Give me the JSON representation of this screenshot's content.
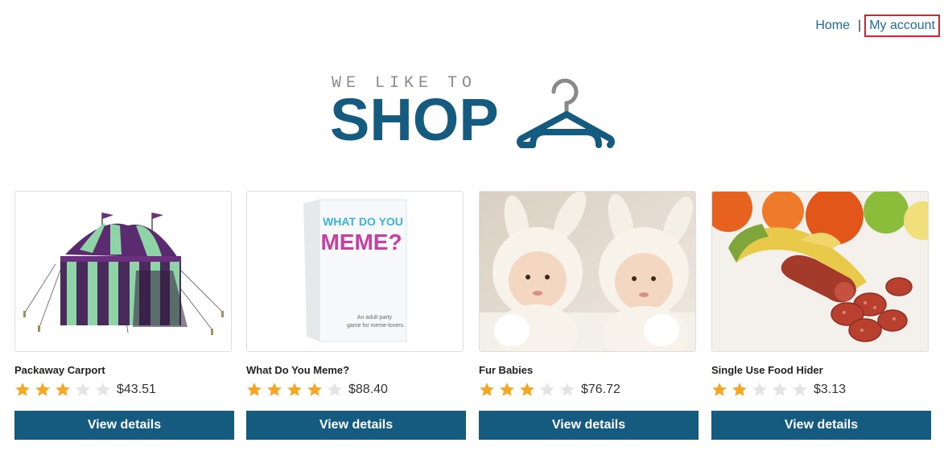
{
  "nav": {
    "home_label": "Home",
    "separator": "|",
    "account_label": "My account",
    "link_color": "#1f6b9e",
    "highlight_color": "#d9232e"
  },
  "logo": {
    "tagline": "WE LIKE TO",
    "word": "SHOP",
    "icon": "hanger-icon",
    "primary_color": "#155b80",
    "tagline_color": "#8a8a8a"
  },
  "products": [
    {
      "name": "Packaway Carport",
      "rating": 3,
      "max_rating": 5,
      "price": "$43.51",
      "button_label": "View details",
      "image": "striped-tent-image"
    },
    {
      "name": "What Do You Meme?",
      "rating": 4,
      "max_rating": 5,
      "price": "$88.40",
      "button_label": "View details",
      "image": "meme-game-box-image",
      "image_text": {
        "line1": "WHAT DO YOU",
        "line2": "MEME?",
        "subtitle1": "An adult party",
        "subtitle2": "game for meme-lovers."
      }
    },
    {
      "name": "Fur Babies",
      "rating": 3,
      "max_rating": 5,
      "price": "$76.72",
      "button_label": "View details",
      "image": "babies-bunny-costume-image"
    },
    {
      "name": "Single Use Food Hider",
      "rating": 2,
      "max_rating": 5,
      "price": "$3.13",
      "button_label": "View details",
      "image": "banana-salami-image"
    }
  ],
  "colors": {
    "button": "#155b80",
    "star_filled": "#f5a623",
    "star_empty": "#e4e4e4"
  }
}
